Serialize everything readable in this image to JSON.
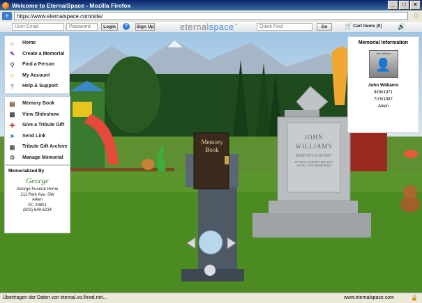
{
  "window": {
    "title": "Welcome to EternalSpace - Mozilla Firefox"
  },
  "address": {
    "url": "https://www.eternalspace.com/site/"
  },
  "site_header": {
    "email_placeholder": "User Email",
    "password_placeholder": "Password",
    "login_label": "Login",
    "signup_label": "Sign Up",
    "logo_prefix": "eternal",
    "logo_accent": "space",
    "logo_tm": "™",
    "quickfind_placeholder": "Quick Find",
    "go_label": "Go",
    "cart_label": "Cart Items (0)"
  },
  "nav_main": [
    {
      "label": "Home",
      "icon": "home-icon"
    },
    {
      "label": "Create a Memorial",
      "icon": "pencil-icon"
    },
    {
      "label": "Find a Person",
      "icon": "magnifier-icon"
    },
    {
      "label": "My Account",
      "icon": "person-icon"
    },
    {
      "label": "Help & Support",
      "icon": "question-icon"
    }
  ],
  "nav_memorial": [
    {
      "label": "Memory Book",
      "icon": "book-icon"
    },
    {
      "label": "View Slideshow",
      "icon": "film-icon"
    },
    {
      "label": "Give a Tribute Gift",
      "icon": "gift-icon"
    },
    {
      "label": "Send Link",
      "icon": "send-icon"
    },
    {
      "label": "Tribute Gift Archive",
      "icon": "archive-icon"
    },
    {
      "label": "Manage Memorial",
      "icon": "gear-icon"
    }
  ],
  "memorialized_by": {
    "header": "Memorialized By",
    "logo_text": "George",
    "lines": [
      "George Funeral Home",
      "211 Park Ave. SW",
      "Aiken",
      "SC 29801",
      "(803) 649-6234"
    ]
  },
  "memorial_info": {
    "header": "Memorial Information",
    "photo_caption": "John Williams",
    "name": "John Williams",
    "born": "8/08/1971",
    "died": "7/15/1997",
    "place": "Aiken"
  },
  "scene": {
    "book_line1": "Memory",
    "book_line2": "Book",
    "stone_first": "JOHN",
    "stone_last": "WILLIAMS",
    "stone_dates": "8/08/1971-7/15/1997",
    "stone_epitaph_1": "IT WAS A SHORT LIFE BUT",
    "stone_epitaph_2": "WITH LONG MEMORIES"
  },
  "status": {
    "text": "Übertragen der Daten von eternal.vo.llnwd.net...",
    "host": "www.eternalspace.com"
  },
  "colors": {
    "titlebar": "#0a246a",
    "accent": "#4a90d9",
    "grass": "#4c8a22",
    "sky": "#9fc5e4"
  }
}
